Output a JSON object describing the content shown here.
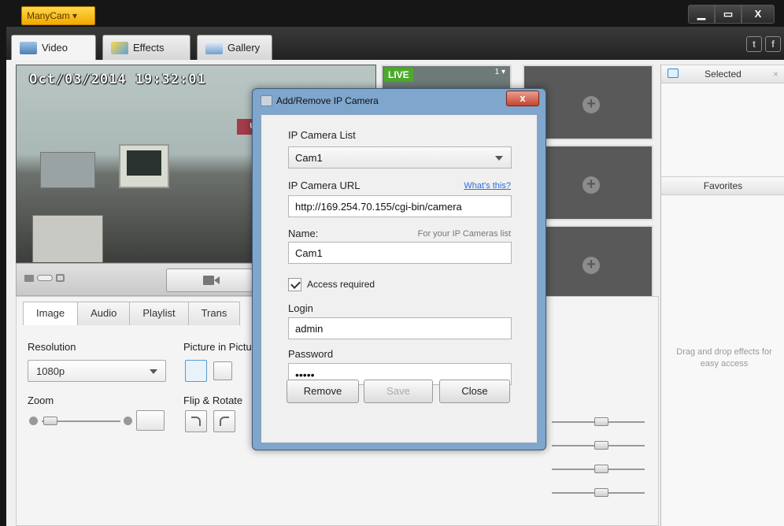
{
  "app": {
    "brand": "ManyCam",
    "brand_caret": "▾"
  },
  "window": {
    "minimize": "▁",
    "maximize": "▭",
    "close": "X"
  },
  "main_tabs": [
    {
      "label": "Video",
      "icon": "video-camera-icon"
    },
    {
      "label": "Effects",
      "icon": "effects-icon"
    },
    {
      "label": "Gallery",
      "icon": "gallery-icon"
    }
  ],
  "social": {
    "twitter": "t",
    "facebook": "f"
  },
  "preview": {
    "timestamp": "Oct/03/2014 19:32:01",
    "sign_text": "UT"
  },
  "thumbnails": {
    "live_label": "LIVE",
    "live_index": "1 ▾"
  },
  "sub_tabs": [
    "Image",
    "Audio",
    "Playlist",
    "Trans"
  ],
  "image_panel": {
    "resolution_label": "Resolution",
    "resolution_value": "1080p",
    "pip_label": "Picture in Pictur",
    "zoom_label": "Zoom",
    "flip_label": "Flip & Rotate"
  },
  "side": {
    "selected": "Selected",
    "selected_close": "×",
    "favorites": "Favorites",
    "hint": "Drag and drop effects for easy access"
  },
  "dialog": {
    "title": "Add/Remove IP Camera",
    "close": "x",
    "list_label": "IP Camera List",
    "list_value": "Cam1",
    "url_label": "IP Camera URL",
    "whats_this": "What's this?",
    "url_value": "http://169.254.70.155/cgi-bin/camera",
    "name_label": "Name:",
    "name_note": "For your IP Cameras list",
    "name_value": "Cam1",
    "access_label": "Access required",
    "access_checked": true,
    "login_label": "Login",
    "login_value": "admin",
    "password_label": "Password",
    "password_value": "•••••",
    "remove": "Remove",
    "save": "Save",
    "close_btn": "Close"
  },
  "colors": {
    "brand": "#f2b400",
    "live": "#4caa2a",
    "link": "#2a6fd6",
    "dialog_frame": "#7fa6cc"
  }
}
